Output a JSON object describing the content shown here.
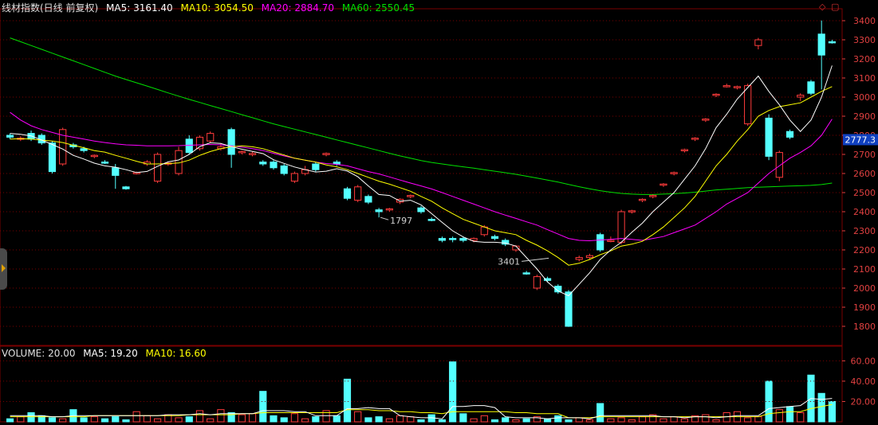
{
  "legend": {
    "title": "线材指数(日线 前复权)",
    "ma5": {
      "label": "MA5: 3161.40",
      "color": "#ffffff"
    },
    "ma10": {
      "label": "MA10: 3054.50",
      "color": "#ffff00"
    },
    "ma20": {
      "label": "MA20: 2884.70",
      "color": "#ff00ff"
    },
    "ma60": {
      "label": "MA60: 2550.45",
      "color": "#00e000"
    }
  },
  "volume_legend": {
    "title": "VOLUME: 20.00",
    "ma5": {
      "label": "MA5: 19.20",
      "color": "#ffffff"
    },
    "ma10": {
      "label": "MA10: 16.60",
      "color": "#ffff00"
    }
  },
  "icons": {
    "diamond": "◇",
    "box": "▢"
  },
  "colors": {
    "up": "#ff3b3b",
    "down": "#54ffff",
    "grid": "#7a0000",
    "axis_text": "#e04040"
  },
  "chart_data": [
    {
      "type": "candlestick",
      "title": "线材指数(日线 前复权)",
      "ylim": [
        1700,
        3450
      ],
      "yticks": [
        1800,
        1900,
        2000,
        2100,
        2200,
        2300,
        2400,
        2500,
        2600,
        2700,
        2800,
        2900,
        3000,
        3100,
        3200,
        3300,
        3400
      ],
      "price_marker": "2777.3",
      "annotations": [
        {
          "label": "3401",
          "index": 49
        },
        {
          "label": "1797",
          "index": 35
        }
      ],
      "candles": [
        [
          2800,
          2790,
          2810,
          2780
        ],
        [
          2780,
          2785,
          2795,
          2770
        ],
        [
          2810,
          2780,
          2825,
          2770
        ],
        [
          2800,
          2760,
          2810,
          2750
        ],
        [
          2760,
          2610,
          2770,
          2600
        ],
        [
          2650,
          2830,
          2840,
          2640
        ],
        [
          2750,
          2740,
          2760,
          2730
        ],
        [
          2730,
          2720,
          2740,
          2710
        ],
        [
          2690,
          2695,
          2700,
          2680
        ],
        [
          2660,
          2655,
          2670,
          2650
        ],
        [
          2630,
          2590,
          2650,
          2520
        ],
        [
          2530,
          2520,
          2535,
          2515
        ],
        [
          2600,
          2605,
          2610,
          2595
        ],
        [
          2650,
          2660,
          2670,
          2640
        ],
        [
          2560,
          2700,
          2710,
          2550
        ],
        [
          2650,
          2655,
          2660,
          2640
        ],
        [
          2600,
          2720,
          2740,
          2590
        ],
        [
          2780,
          2710,
          2800,
          2700
        ],
        [
          2730,
          2790,
          2800,
          2720
        ],
        [
          2770,
          2810,
          2820,
          2760
        ],
        [
          2730,
          2740,
          2760,
          2720
        ],
        [
          2830,
          2700,
          2840,
          2630
        ],
        [
          2710,
          2715,
          2720,
          2700
        ],
        [
          2700,
          2705,
          2715,
          2690
        ],
        [
          2660,
          2650,
          2670,
          2640
        ],
        [
          2660,
          2630,
          2670,
          2620
        ],
        [
          2640,
          2600,
          2650,
          2590
        ],
        [
          2560,
          2600,
          2610,
          2550
        ],
        [
          2600,
          2620,
          2640,
          2590
        ],
        [
          2650,
          2620,
          2660,
          2610
        ],
        [
          2700,
          2705,
          2710,
          2690
        ],
        [
          2660,
          2650,
          2670,
          2640
        ],
        [
          2520,
          2470,
          2530,
          2460
        ],
        [
          2460,
          2530,
          2540,
          2450
        ],
        [
          2480,
          2450,
          2490,
          2440
        ],
        [
          2410,
          2400,
          2420,
          2370
        ],
        [
          2410,
          2415,
          2420,
          2400
        ],
        [
          2450,
          2465,
          2470,
          2440
        ],
        [
          2480,
          2485,
          2490,
          2470
        ],
        [
          2420,
          2400,
          2430,
          2390
        ],
        [
          2360,
          2355,
          2370,
          2350
        ],
        [
          2260,
          2250,
          2270,
          2240
        ],
        [
          2260,
          2255,
          2270,
          2240
        ],
        [
          2260,
          2250,
          2270,
          2240
        ],
        [
          2250,
          2260,
          2265,
          2240
        ],
        [
          2280,
          2320,
          2330,
          2270
        ],
        [
          2270,
          2260,
          2280,
          2250
        ],
        [
          2250,
          2230,
          2260,
          2220
        ],
        [
          2200,
          2220,
          2225,
          2190
        ],
        [
          2080,
          2075,
          2090,
          2070
        ],
        [
          2000,
          2060,
          2070,
          1990
        ],
        [
          2050,
          2040,
          2060,
          2030
        ],
        [
          2010,
          1980,
          2020,
          1970
        ],
        [
          1980,
          1800,
          1990,
          1797
        ],
        [
          2150,
          2160,
          2170,
          2140
        ],
        [
          2160,
          2170,
          2180,
          2150
        ],
        [
          2280,
          2200,
          2290,
          2190
        ],
        [
          2250,
          2250,
          2270,
          2240
        ],
        [
          2240,
          2400,
          2410,
          2230
        ],
        [
          2400,
          2405,
          2410,
          2390
        ],
        [
          2460,
          2465,
          2470,
          2450
        ],
        [
          2480,
          2485,
          2490,
          2470
        ],
        [
          2540,
          2545,
          2550,
          2530
        ],
        [
          2600,
          2605,
          2610,
          2590
        ],
        [
          2720,
          2725,
          2730,
          2710
        ],
        [
          2780,
          2785,
          2790,
          2770
        ],
        [
          2880,
          2885,
          2890,
          2870
        ],
        [
          3010,
          3015,
          3020,
          3000
        ],
        [
          3060,
          3060,
          3070,
          3050
        ],
        [
          3050,
          3055,
          3060,
          3040
        ],
        [
          2860,
          3060,
          3070,
          2850
        ],
        [
          3270,
          3300,
          3310,
          3250
        ],
        [
          2890,
          2690,
          2910,
          2670
        ],
        [
          2580,
          2710,
          2720,
          2560
        ],
        [
          2820,
          2790,
          2830,
          2780
        ],
        [
          3000,
          3010,
          3020,
          2980
        ],
        [
          3080,
          3020,
          3090,
          3010
        ],
        [
          3330,
          3220,
          3401,
          3040
        ],
        [
          3290,
          3285,
          3300,
          3280
        ]
      ],
      "ma5": [
        2810,
        2805,
        2797,
        2775,
        2752,
        2728,
        2695,
        2676,
        2654,
        2640,
        2633,
        2620,
        2605,
        2611,
        2638,
        2661,
        2671,
        2700,
        2741,
        2761,
        2757,
        2741,
        2727,
        2716,
        2704,
        2672,
        2653,
        2634,
        2620,
        2608,
        2612,
        2625,
        2613,
        2583,
        2535,
        2490,
        2485,
        2455,
        2460,
        2436,
        2390,
        2344,
        2300,
        2268,
        2245,
        2240,
        2240,
        2236,
        2220,
        2160,
        2100,
        2032,
        1985,
        1960,
        2020,
        2080,
        2150,
        2200,
        2240,
        2292,
        2340,
        2400,
        2450,
        2500,
        2570,
        2640,
        2730,
        2840,
        2910,
        2990,
        3050,
        3110,
        3030,
        2960,
        2880,
        2820,
        2880,
        3000,
        3165
      ],
      "ma10": [
        2780,
        2782,
        2780,
        2775,
        2770,
        2762,
        2748,
        2735,
        2720,
        2712,
        2695,
        2680,
        2664,
        2650,
        2650,
        2652,
        2655,
        2670,
        2695,
        2715,
        2730,
        2740,
        2745,
        2740,
        2730,
        2713,
        2697,
        2680,
        2670,
        2660,
        2645,
        2635,
        2620,
        2600,
        2580,
        2560,
        2544,
        2526,
        2507,
        2480,
        2455,
        2420,
        2390,
        2360,
        2340,
        2320,
        2300,
        2290,
        2280,
        2250,
        2225,
        2195,
        2160,
        2120,
        2130,
        2150,
        2175,
        2195,
        2220,
        2230,
        2245,
        2280,
        2320,
        2370,
        2420,
        2480,
        2560,
        2640,
        2700,
        2770,
        2830,
        2900,
        2930,
        2950,
        2960,
        2970,
        3000,
        3030,
        3055
      ],
      "ma20": [
        2920,
        2880,
        2850,
        2830,
        2815,
        2800,
        2790,
        2780,
        2770,
        2762,
        2755,
        2750,
        2748,
        2745,
        2745,
        2745,
        2746,
        2748,
        2750,
        2752,
        2750,
        2745,
        2738,
        2730,
        2720,
        2706,
        2692,
        2680,
        2670,
        2660,
        2652,
        2648,
        2640,
        2625,
        2610,
        2598,
        2582,
        2566,
        2550,
        2535,
        2519,
        2500,
        2480,
        2460,
        2440,
        2420,
        2400,
        2382,
        2365,
        2347,
        2330,
        2306,
        2283,
        2260,
        2250,
        2248,
        2252,
        2255,
        2260,
        2255,
        2250,
        2260,
        2270,
        2290,
        2310,
        2330,
        2365,
        2400,
        2440,
        2470,
        2500,
        2550,
        2600,
        2640,
        2680,
        2710,
        2745,
        2800,
        2885
      ],
      "ma60": [
        3310,
        3290,
        3270,
        3250,
        3230,
        3210,
        3190,
        3170,
        3150,
        3130,
        3110,
        3092,
        3075,
        3058,
        3040,
        3022,
        3005,
        2988,
        2972,
        2956,
        2940,
        2924,
        2908,
        2892,
        2876,
        2860,
        2846,
        2832,
        2818,
        2804,
        2790,
        2776,
        2762,
        2748,
        2734,
        2720,
        2706,
        2692,
        2680,
        2668,
        2658,
        2650,
        2642,
        2635,
        2628,
        2620,
        2612,
        2604,
        2596,
        2586,
        2576,
        2566,
        2555,
        2543,
        2531,
        2520,
        2510,
        2502,
        2496,
        2492,
        2490,
        2490,
        2492,
        2494,
        2498,
        2502,
        2508,
        2514,
        2518,
        2522,
        2526,
        2528,
        2530,
        2532,
        2534,
        2536,
        2538,
        2542,
        2550
      ]
    },
    {
      "type": "bar",
      "title": "VOLUME: 20.00",
      "ylim": [
        0,
        65
      ],
      "yticks": [
        20,
        40,
        60
      ],
      "values": [
        3,
        5,
        9,
        6,
        4,
        3,
        12,
        4,
        5,
        3,
        5,
        2,
        10,
        6,
        3,
        7,
        4,
        5,
        11,
        3,
        12,
        9,
        7,
        8,
        30,
        6,
        4,
        8,
        3,
        5,
        11,
        6,
        42,
        10,
        4,
        5,
        3,
        6,
        5,
        2,
        7,
        2,
        59,
        8,
        3,
        6,
        2,
        4,
        2,
        3,
        5,
        3,
        6,
        2,
        4,
        2,
        18,
        3,
        4,
        2,
        5,
        7,
        3,
        5,
        3,
        6,
        7,
        2,
        9,
        10,
        4,
        5,
        40,
        12,
        15,
        9,
        46,
        28,
        20
      ],
      "ma5": [
        6,
        6,
        6,
        6,
        5,
        5,
        6,
        6,
        6,
        6,
        6,
        6,
        6,
        6,
        6,
        7,
        7,
        7,
        8,
        7,
        8,
        8,
        8,
        8,
        11,
        11,
        11,
        10,
        10,
        6,
        6,
        6,
        13,
        13,
        14,
        13,
        13,
        6,
        5,
        4,
        4,
        3,
        15,
        15,
        16,
        16,
        14,
        5,
        4,
        4,
        4,
        3,
        4,
        4,
        4,
        3,
        6,
        6,
        6,
        6,
        6,
        6,
        5,
        5,
        4,
        5,
        5,
        4,
        5,
        6,
        6,
        6,
        13,
        14,
        15,
        16,
        23,
        22,
        23
      ],
      "ma10": [
        5,
        5,
        5,
        5,
        5,
        5,
        5,
        5,
        6,
        6,
        6,
        6,
        6,
        6,
        6,
        6,
        6,
        7,
        7,
        7,
        7,
        7,
        8,
        8,
        9,
        9,
        9,
        9,
        9,
        9,
        9,
        9,
        12,
        12,
        12,
        11,
        11,
        10,
        10,
        9,
        9,
        8,
        10,
        10,
        10,
        10,
        10,
        10,
        9,
        9,
        8,
        8,
        8,
        4,
        4,
        4,
        5,
        5,
        5,
        5,
        5,
        5,
        5,
        5,
        5,
        5,
        5,
        5,
        5,
        5,
        5,
        5,
        8,
        9,
        10,
        10,
        13,
        15,
        17
      ]
    }
  ]
}
